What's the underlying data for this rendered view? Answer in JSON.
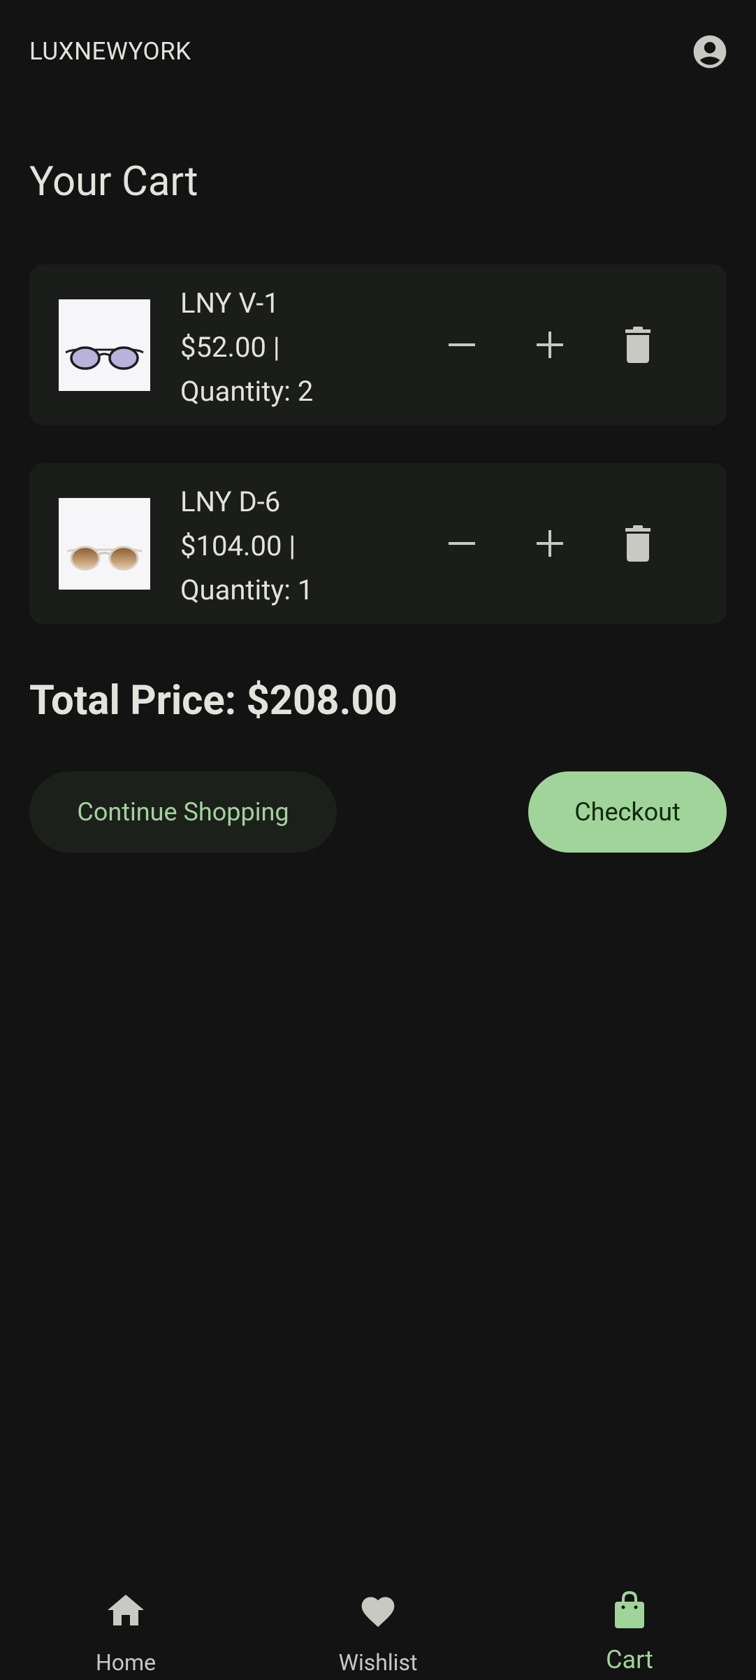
{
  "app": {
    "brand": "LUXNEWYORK"
  },
  "page": {
    "title": "Your Cart"
  },
  "cart": {
    "items": [
      {
        "name": "LNY V-1",
        "price": "$52.00 |",
        "quantity": "Quantity: 2",
        "image_icon": "round-sunglasses-lavender-icon"
      },
      {
        "name": "LNY D-6",
        "price": "$104.00 |",
        "quantity": "Quantity: 1",
        "image_icon": "round-sunglasses-amber-icon"
      }
    ],
    "total": "Total Price: $208.00"
  },
  "actions": {
    "continue_label": "Continue Shopping",
    "checkout_label": "Checkout"
  },
  "nav": {
    "items": [
      {
        "label": "Home",
        "icon": "home-icon"
      },
      {
        "label": "Wishlist",
        "icon": "heart-icon"
      },
      {
        "label": "Cart",
        "icon": "shopping-bag-icon",
        "active": true
      }
    ]
  },
  "colors": {
    "background": "#131313",
    "card": "#1a1d19",
    "accent": "#a1d49a",
    "text": "#e3e3dc",
    "icon": "#c8c9c2"
  }
}
